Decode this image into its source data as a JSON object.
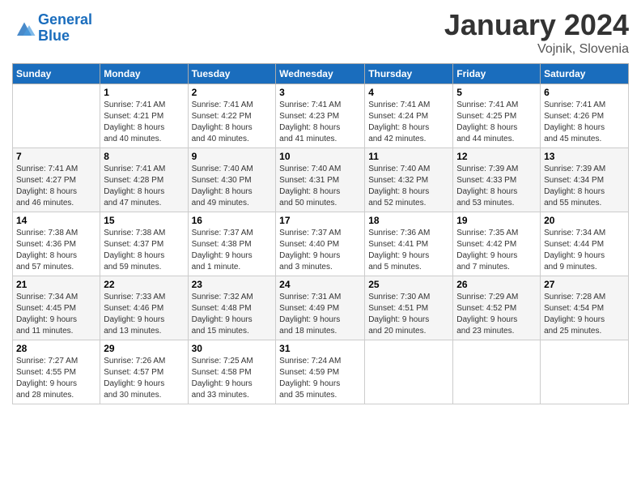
{
  "logo": {
    "line1": "General",
    "line2": "Blue"
  },
  "title": "January 2024",
  "subtitle": "Vojnik, Slovenia",
  "days_of_week": [
    "Sunday",
    "Monday",
    "Tuesday",
    "Wednesday",
    "Thursday",
    "Friday",
    "Saturday"
  ],
  "weeks": [
    [
      {
        "day": "",
        "info": ""
      },
      {
        "day": "1",
        "info": "Sunrise: 7:41 AM\nSunset: 4:21 PM\nDaylight: 8 hours\nand 40 minutes."
      },
      {
        "day": "2",
        "info": "Sunrise: 7:41 AM\nSunset: 4:22 PM\nDaylight: 8 hours\nand 40 minutes."
      },
      {
        "day": "3",
        "info": "Sunrise: 7:41 AM\nSunset: 4:23 PM\nDaylight: 8 hours\nand 41 minutes."
      },
      {
        "day": "4",
        "info": "Sunrise: 7:41 AM\nSunset: 4:24 PM\nDaylight: 8 hours\nand 42 minutes."
      },
      {
        "day": "5",
        "info": "Sunrise: 7:41 AM\nSunset: 4:25 PM\nDaylight: 8 hours\nand 44 minutes."
      },
      {
        "day": "6",
        "info": "Sunrise: 7:41 AM\nSunset: 4:26 PM\nDaylight: 8 hours\nand 45 minutes."
      }
    ],
    [
      {
        "day": "7",
        "info": "Sunrise: 7:41 AM\nSunset: 4:27 PM\nDaylight: 8 hours\nand 46 minutes."
      },
      {
        "day": "8",
        "info": "Sunrise: 7:41 AM\nSunset: 4:28 PM\nDaylight: 8 hours\nand 47 minutes."
      },
      {
        "day": "9",
        "info": "Sunrise: 7:40 AM\nSunset: 4:30 PM\nDaylight: 8 hours\nand 49 minutes."
      },
      {
        "day": "10",
        "info": "Sunrise: 7:40 AM\nSunset: 4:31 PM\nDaylight: 8 hours\nand 50 minutes."
      },
      {
        "day": "11",
        "info": "Sunrise: 7:40 AM\nSunset: 4:32 PM\nDaylight: 8 hours\nand 52 minutes."
      },
      {
        "day": "12",
        "info": "Sunrise: 7:39 AM\nSunset: 4:33 PM\nDaylight: 8 hours\nand 53 minutes."
      },
      {
        "day": "13",
        "info": "Sunrise: 7:39 AM\nSunset: 4:34 PM\nDaylight: 8 hours\nand 55 minutes."
      }
    ],
    [
      {
        "day": "14",
        "info": "Sunrise: 7:38 AM\nSunset: 4:36 PM\nDaylight: 8 hours\nand 57 minutes."
      },
      {
        "day": "15",
        "info": "Sunrise: 7:38 AM\nSunset: 4:37 PM\nDaylight: 8 hours\nand 59 minutes."
      },
      {
        "day": "16",
        "info": "Sunrise: 7:37 AM\nSunset: 4:38 PM\nDaylight: 9 hours\nand 1 minute."
      },
      {
        "day": "17",
        "info": "Sunrise: 7:37 AM\nSunset: 4:40 PM\nDaylight: 9 hours\nand 3 minutes."
      },
      {
        "day": "18",
        "info": "Sunrise: 7:36 AM\nSunset: 4:41 PM\nDaylight: 9 hours\nand 5 minutes."
      },
      {
        "day": "19",
        "info": "Sunrise: 7:35 AM\nSunset: 4:42 PM\nDaylight: 9 hours\nand 7 minutes."
      },
      {
        "day": "20",
        "info": "Sunrise: 7:34 AM\nSunset: 4:44 PM\nDaylight: 9 hours\nand 9 minutes."
      }
    ],
    [
      {
        "day": "21",
        "info": "Sunrise: 7:34 AM\nSunset: 4:45 PM\nDaylight: 9 hours\nand 11 minutes."
      },
      {
        "day": "22",
        "info": "Sunrise: 7:33 AM\nSunset: 4:46 PM\nDaylight: 9 hours\nand 13 minutes."
      },
      {
        "day": "23",
        "info": "Sunrise: 7:32 AM\nSunset: 4:48 PM\nDaylight: 9 hours\nand 15 minutes."
      },
      {
        "day": "24",
        "info": "Sunrise: 7:31 AM\nSunset: 4:49 PM\nDaylight: 9 hours\nand 18 minutes."
      },
      {
        "day": "25",
        "info": "Sunrise: 7:30 AM\nSunset: 4:51 PM\nDaylight: 9 hours\nand 20 minutes."
      },
      {
        "day": "26",
        "info": "Sunrise: 7:29 AM\nSunset: 4:52 PM\nDaylight: 9 hours\nand 23 minutes."
      },
      {
        "day": "27",
        "info": "Sunrise: 7:28 AM\nSunset: 4:54 PM\nDaylight: 9 hours\nand 25 minutes."
      }
    ],
    [
      {
        "day": "28",
        "info": "Sunrise: 7:27 AM\nSunset: 4:55 PM\nDaylight: 9 hours\nand 28 minutes."
      },
      {
        "day": "29",
        "info": "Sunrise: 7:26 AM\nSunset: 4:57 PM\nDaylight: 9 hours\nand 30 minutes."
      },
      {
        "day": "30",
        "info": "Sunrise: 7:25 AM\nSunset: 4:58 PM\nDaylight: 9 hours\nand 33 minutes."
      },
      {
        "day": "31",
        "info": "Sunrise: 7:24 AM\nSunset: 4:59 PM\nDaylight: 9 hours\nand 35 minutes."
      },
      {
        "day": "",
        "info": ""
      },
      {
        "day": "",
        "info": ""
      },
      {
        "day": "",
        "info": ""
      }
    ]
  ]
}
